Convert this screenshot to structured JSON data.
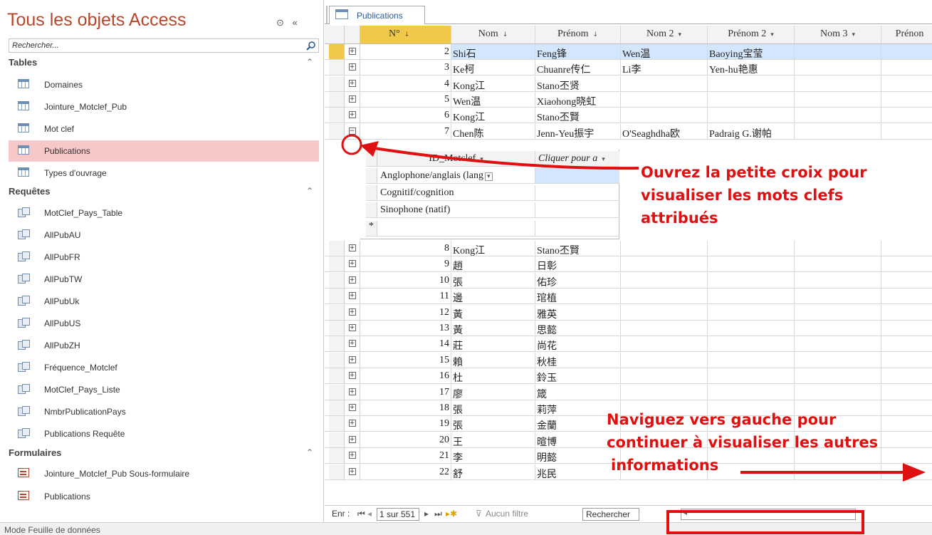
{
  "nav": {
    "title": "Tous les objets Access",
    "controls": "⊙ «",
    "search_placeholder": "Rechercher...",
    "sections": [
      {
        "label": "Tables",
        "items": [
          "Domaines",
          "Jointure_Motclef_Pub",
          "Mot clef",
          "Publications",
          "Types d'ouvrage"
        ]
      },
      {
        "label": "Requêtes",
        "items": [
          "MotClef_Pays_Table",
          "AllPubAU",
          "AllPubFR",
          "AllPubTW",
          "AllPubUk",
          "AllPubUS",
          "AllPubZH",
          "Fréquence_Motclef",
          "MotClef_Pays_Liste",
          "NmbrPublicationPays",
          "Publications Requête"
        ]
      },
      {
        "label": "Formulaires",
        "items": [
          "Jointure_Motclef_Pub Sous-formulaire",
          "Publications"
        ]
      }
    ],
    "selected_item": "Publications"
  },
  "tab": {
    "label": "Publications"
  },
  "grid": {
    "headers": [
      "N°",
      "Nom",
      "Prénom",
      "Nom 2",
      "Prénom 2",
      "Nom 3",
      "Prénon"
    ],
    "rows_top": [
      {
        "n": "2",
        "nom": "Shi石",
        "prenom": "Feng锋",
        "nom2": "Wen温",
        "prenom2": "Baoying宝莹"
      },
      {
        "n": "3",
        "nom": "Ke柯",
        "prenom": "Chuanre传仁",
        "nom2": "Li李",
        "prenom2": "Yen-hu艳惠"
      },
      {
        "n": "4",
        "nom": "Kong江",
        "prenom": "Stano丕贤",
        "nom2": "",
        "prenom2": ""
      },
      {
        "n": "5",
        "nom": "Wen温",
        "prenom": "Xiaohong晓虹",
        "nom2": "",
        "prenom2": ""
      },
      {
        "n": "6",
        "nom": "Kong江",
        "prenom": "Stano丕賢",
        "nom2": "",
        "prenom2": ""
      },
      {
        "n": "7",
        "nom": "Chen陈",
        "prenom": "Jenn-Yeu振宇",
        "nom2": "O'Seaghdha欧",
        "prenom2": "Padraig G.谢帕"
      }
    ],
    "rows_bottom": [
      {
        "n": "8",
        "nom": "Kong江",
        "prenom": "Stano丕賢"
      },
      {
        "n": "9",
        "nom": "趙",
        "prenom": "日彰"
      },
      {
        "n": "10",
        "nom": "張",
        "prenom": "佑珍"
      },
      {
        "n": "11",
        "nom": "邊",
        "prenom": "琯植"
      },
      {
        "n": "12",
        "nom": "黃",
        "prenom": "雅英"
      },
      {
        "n": "13",
        "nom": "黃",
        "prenom": "思懿"
      },
      {
        "n": "14",
        "nom": "莊",
        "prenom": "尚花"
      },
      {
        "n": "15",
        "nom": "賴",
        "prenom": "秋桂"
      },
      {
        "n": "16",
        "nom": "杜",
        "prenom": "鈴玉"
      },
      {
        "n": "17",
        "nom": "廖",
        "prenom": "箴"
      },
      {
        "n": "18",
        "nom": "張",
        "prenom": "莉萍"
      },
      {
        "n": "19",
        "nom": "張",
        "prenom": "金蘭"
      },
      {
        "n": "20",
        "nom": "王",
        "prenom": "暄博"
      },
      {
        "n": "21",
        "nom": "李",
        "prenom": "明懿"
      },
      {
        "n": "22",
        "nom": "舒",
        "prenom": "兆民"
      }
    ]
  },
  "subgrid": {
    "headers": [
      "ID_Motclef",
      "Cliquer pour a"
    ],
    "rows": [
      "Anglophone/anglais (lang",
      "Cognitif/cognition",
      "Sinophone (natif)"
    ],
    "new_row_marker": "*"
  },
  "navbar": {
    "prefix": "Enr :",
    "record": "1 sur 551",
    "filter": "Aucun filtre",
    "search": "Rechercher"
  },
  "status": "Mode Feuille de données",
  "annotations": {
    "open": "Ouvrez la petite croix pour visualiser les mots clefs attribués",
    "open_lines": [
      "Ouvrez la petite croix pour",
      "visualiser les mots clefs",
      "attribués"
    ],
    "navigate_lines": [
      "Naviguez vers gauche pour",
      "continuer à visualiser les autres",
      "informations"
    ],
    "color": "#e01010"
  },
  "colors": {
    "access_red": "#b7472a",
    "selected_bg": "#f8c8c8",
    "header_sort": "#f0c84a",
    "row_selected": "#d4e6fb"
  }
}
